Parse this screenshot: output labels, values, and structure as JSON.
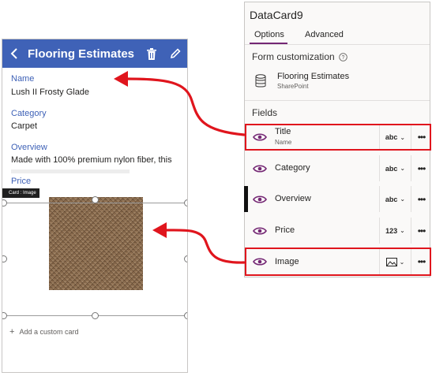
{
  "phone": {
    "title": "Flooring Estimates",
    "fields": [
      {
        "label": "Name",
        "value": "Lush II Frosty Glade"
      },
      {
        "label": "Category",
        "value": "Carpet"
      },
      {
        "label": "Overview",
        "value": "Made with 100% premium nylon fiber, this"
      },
      {
        "label": "Price",
        "value": ""
      }
    ],
    "card_tag": "Card : Image",
    "add_card": "Add a custom card"
  },
  "panel": {
    "title": "DataCard9",
    "tabs": [
      "Options",
      "Advanced"
    ],
    "active_tab": "Options",
    "form_customization": "Form customization",
    "datasource": {
      "name": "Flooring Estimates",
      "sub": "SharePoint"
    },
    "fields_heading": "Fields",
    "rows": [
      {
        "name": "Title",
        "sub": "Name",
        "type": "abc",
        "highlight": true
      },
      {
        "name": "Category",
        "type": "abc"
      },
      {
        "name": "Overview",
        "type": "abc",
        "active": true
      },
      {
        "name": "Price",
        "type": "123"
      },
      {
        "name": "Image",
        "type": "image-icon",
        "highlight": true
      }
    ]
  },
  "colors": {
    "header_blue": "#3f62b7",
    "accent_purple": "#742774",
    "highlight_red": "#e0151d"
  }
}
